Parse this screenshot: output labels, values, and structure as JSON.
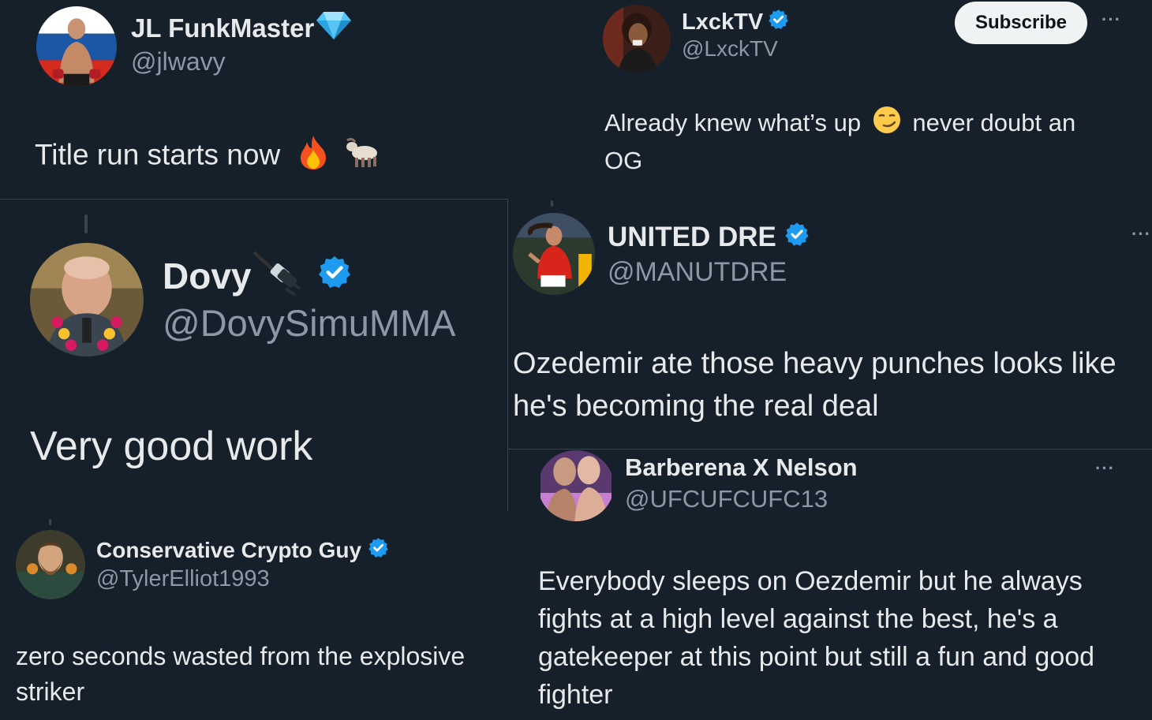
{
  "tweets": [
    {
      "id": "jl",
      "name": "JL FunkMaster",
      "handle": "@jlwavy",
      "text": "Title run starts now"
    },
    {
      "id": "lxck",
      "name": "LxckTV",
      "handle": "@LxckTV",
      "text": "Already knew what’s up",
      "text_after": "never doubt an OG",
      "subscribe_label": "Subscribe",
      "more": "···"
    },
    {
      "id": "dovy",
      "name": "Dovy",
      "handle": "@DovySimuMMA",
      "text": "Very good work"
    },
    {
      "id": "dre",
      "name": "UNITED DRE",
      "handle": "@MANUTDRE",
      "text": "Ozedemir ate those heavy punches looks like he's becoming the real deal",
      "more": "···"
    },
    {
      "id": "barberena",
      "name": "Barberena X Nelson",
      "handle": "@UFCUFCUFC13",
      "text": "Everybody sleeps on Oezdemir but he always fights at a high level against the best, he's a gatekeeper at this point but still a fun and good fighter",
      "more": "···"
    },
    {
      "id": "crypto",
      "name": "Conservative Crypto Guy",
      "handle": "@TylerElliot1993",
      "text": "zero seconds wasted from the explosive striker"
    }
  ],
  "colors": {
    "background": "#15202b",
    "text": "#e7e9ea",
    "secondary": "#8b98a5",
    "verified": "#1d9bf0",
    "divider": "#38444d"
  },
  "icons": [
    "diamond-icon",
    "verified-badge-icon",
    "fire-emoji-icon",
    "goat-emoji-icon",
    "smirk-emoji-icon",
    "plug-emoji-icon",
    "more-options-icon"
  ]
}
